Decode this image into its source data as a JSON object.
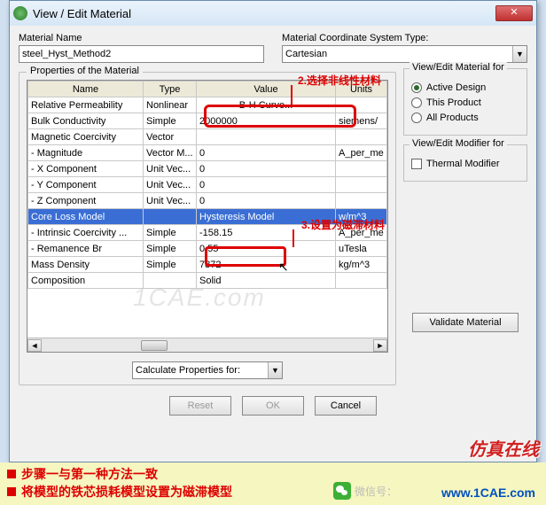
{
  "window": {
    "title": "View / Edit Material"
  },
  "top": {
    "material_name_label": "Material Name",
    "material_name_value": "steel_Hyst_Method2",
    "coord_label": "Material Coordinate System Type:",
    "coord_value": "Cartesian"
  },
  "annotations": {
    "a2": "2.选择非线性材料",
    "a3": "3.设置为磁滞材料"
  },
  "group_title": "Properties of the Material",
  "headers": {
    "name": "Name",
    "type": "Type",
    "value": "Value",
    "units": "Units"
  },
  "rows": [
    {
      "name": "Relative Permeability",
      "type": "Nonlinear",
      "value": "B-H Curve...",
      "units": "",
      "valcenter": true
    },
    {
      "name": "Bulk Conductivity",
      "type": "Simple",
      "value": "2000000",
      "units": "siemens/"
    },
    {
      "name": "Magnetic Coercivity",
      "type": "Vector",
      "value": "",
      "units": ""
    },
    {
      "name": "- Magnitude",
      "type": "Vector M...",
      "value": "0",
      "units": "A_per_me"
    },
    {
      "name": "- X Component",
      "type": "Unit Vec...",
      "value": "0",
      "units": ""
    },
    {
      "name": "- Y Component",
      "type": "Unit Vec...",
      "value": "0",
      "units": ""
    },
    {
      "name": "- Z Component",
      "type": "Unit Vec...",
      "value": "0",
      "units": ""
    },
    {
      "name": "Core Loss Model",
      "type": "",
      "value": "Hysteresis Model",
      "units": "w/m^3",
      "selected": true
    },
    {
      "name": "- Intrinsic Coercivity ...",
      "type": "Simple",
      "value": "-158.15",
      "units": "A_per_me"
    },
    {
      "name": "- Remanence Br",
      "type": "Simple",
      "value": "0.55",
      "units": "uTesla"
    },
    {
      "name": "Mass Density",
      "type": "Simple",
      "value": "7872",
      "units": "kg/m^3"
    },
    {
      "name": "Composition",
      "type": "",
      "value": "Solid",
      "units": ""
    }
  ],
  "right": {
    "view_for_title": "View/Edit Material for",
    "r1": "Active Design",
    "r2": "This Product",
    "r3": "All Products",
    "mod_for_title": "View/Edit Modifier for",
    "thermal": "Thermal Modifier",
    "validate": "Validate Material"
  },
  "bottom": {
    "calc_label": "Calculate Properties for:"
  },
  "buttons": {
    "reset": "Reset",
    "ok": "OK",
    "cancel": "Cancel"
  },
  "footer": {
    "line1": "步骤一与第一种方法一致",
    "line2": "将模型的铁芯损耗模型设置为磁滞模型"
  },
  "wechat_label": "微信号：",
  "brand": "仿真在线",
  "website": "www.1CAE.com",
  "watermark": "1CAE.com"
}
